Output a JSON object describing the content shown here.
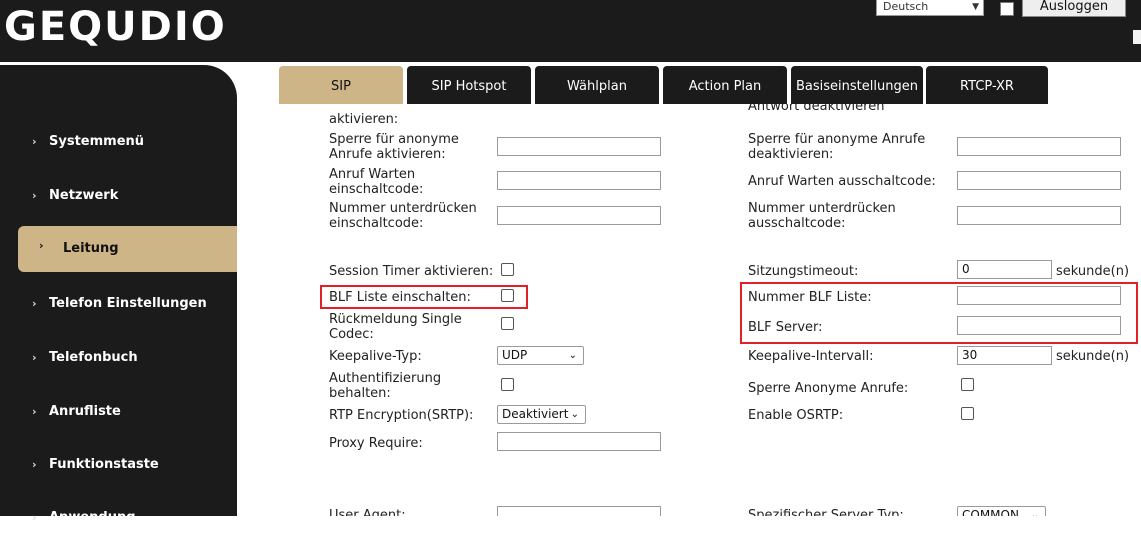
{
  "header": {
    "logo": "GEQUDIO",
    "language": "Deutsch",
    "logout_label": "Ausloggen"
  },
  "sidebar": {
    "items": [
      {
        "label": "Systemmenü"
      },
      {
        "label": "Netzwerk"
      },
      {
        "label": "Leitung",
        "active": true
      },
      {
        "label": "Telefon Einstellungen"
      },
      {
        "label": "Telefonbuch"
      },
      {
        "label": "Anrufliste"
      },
      {
        "label": "Funktionstaste"
      },
      {
        "label": "Anwendung"
      }
    ]
  },
  "tabs": [
    {
      "label": "SIP",
      "active": true
    },
    {
      "label": "SIP Hotspot"
    },
    {
      "label": "Wählplan"
    },
    {
      "label": "Action Plan"
    },
    {
      "label": "Basiseinstellungen"
    },
    {
      "label": "RTCP-XR"
    }
  ],
  "form": {
    "left_top_cut": "aktivieren:",
    "right_top_cut": "Antwort deaktivieren",
    "anon_block_on": "Sperre für anonyme Anrufe aktivieren:",
    "anon_block_off": "Sperre für anonyme Anrufe deaktivieren:",
    "call_wait_on": "Anruf Warten einschaltcode:",
    "call_wait_off": "Anruf Warten ausschaltcode:",
    "hide_number_on": "Nummer unterdrücken einschaltcode:",
    "hide_number_off": "Nummer unterdrücken ausschaltcode:",
    "session_timer_label": "Session Timer aktivieren:",
    "session_timeout_label": "Sitzungstimeout:",
    "session_timeout_value": "0",
    "seconds_unit": "sekunde(n)",
    "blf_list_enable_label": "BLF Liste einschalten:",
    "blf_list_number_label": "Nummer BLF Liste:",
    "single_codec_label": "Rückmeldung Single Codec:",
    "blf_server_label": "BLF Server:",
    "keepalive_type_label": "Keepalive-Typ:",
    "keepalive_type_value": "UDP",
    "keepalive_interval_label": "Keepalive-Intervall:",
    "keepalive_interval_value": "30",
    "keep_auth_label": "Authentifizierung behalten:",
    "block_anon_label": "Sperre Anonyme Anrufe:",
    "rtp_encryption_label": "RTP Encryption(SRTP):",
    "rtp_encryption_value": "Deaktiviert",
    "enable_osrtp_label": "Enable OSRTP:",
    "proxy_require_label": "Proxy Require:",
    "user_agent_label": "User Agent:",
    "server_type_label": "Spezifischer Server Typ:",
    "server_type_value": "COMMON"
  },
  "colors": {
    "dark": "#1b1b1b",
    "accent": "#cdb588",
    "highlight": "#e2202a"
  }
}
